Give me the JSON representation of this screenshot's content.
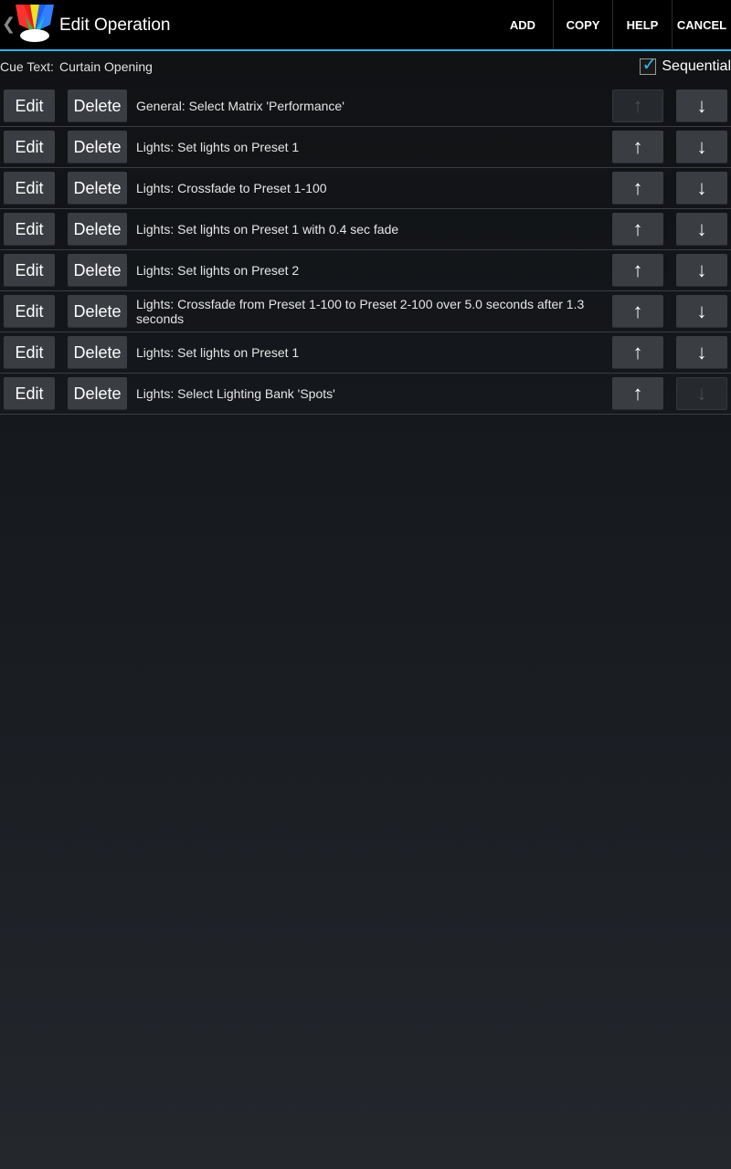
{
  "header": {
    "title": "Edit Operation",
    "actions": [
      "ADD",
      "COPY",
      "HELP",
      "CANCEL"
    ]
  },
  "cue": {
    "label": "Cue Text:",
    "value": "Curtain Opening",
    "sequential_label": "Sequential",
    "sequential_checked": true
  },
  "buttons": {
    "edit": "Edit",
    "delete": "Delete",
    "up": "↑",
    "down": "↓"
  },
  "operations": [
    {
      "text": "General: Select Matrix 'Performance'",
      "up_enabled": false,
      "down_enabled": true
    },
    {
      "text": "Lights: Set lights on Preset 1",
      "up_enabled": true,
      "down_enabled": true
    },
    {
      "text": "Lights: Crossfade to Preset 1-100",
      "up_enabled": true,
      "down_enabled": true
    },
    {
      "text": "Lights: Set lights on Preset 1 with 0.4 sec fade",
      "up_enabled": true,
      "down_enabled": true
    },
    {
      "text": "Lights: Set lights on Preset 2",
      "up_enabled": true,
      "down_enabled": true
    },
    {
      "text": "Lights: Crossfade from Preset 1-100 to Preset 2-100 over 5.0 seconds after 1.3 seconds",
      "up_enabled": true,
      "down_enabled": true
    },
    {
      "text": "Lights: Set lights on Preset 1",
      "up_enabled": true,
      "down_enabled": true
    },
    {
      "text": "Lights: Select Lighting Bank 'Spots'",
      "up_enabled": true,
      "down_enabled": false
    }
  ],
  "colors": {
    "accent": "#33b5e5",
    "button": "#3a3d42",
    "actionbar": "#000000"
  }
}
